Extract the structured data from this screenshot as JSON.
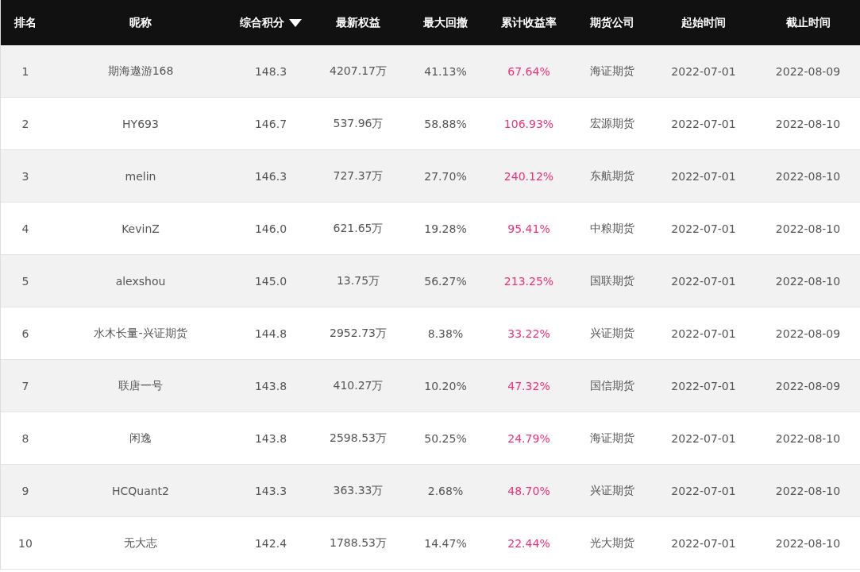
{
  "table": {
    "columns": [
      {
        "label": "排名",
        "sorted": false
      },
      {
        "label": "昵称",
        "sorted": false
      },
      {
        "label": "综合积分",
        "sorted": true
      },
      {
        "label": "最新权益",
        "sorted": false
      },
      {
        "label": "最大回撤",
        "sorted": false
      },
      {
        "label": "累计收益率",
        "sorted": false
      },
      {
        "label": "期货公司",
        "sorted": false
      },
      {
        "label": "起始时间",
        "sorted": false
      },
      {
        "label": "截止时间",
        "sorted": false
      }
    ],
    "rows": [
      [
        "1",
        "期海遨游168",
        "148.3",
        "4207.17万",
        "41.13%",
        "67.64%",
        "海证期货",
        "2022-07-01",
        "2022-08-09"
      ],
      [
        "2",
        "HY693",
        "146.7",
        "537.96万",
        "58.88%",
        "106.93%",
        "宏源期货",
        "2022-07-01",
        "2022-08-10"
      ],
      [
        "3",
        "melin",
        "146.3",
        "727.37万",
        "27.70%",
        "240.12%",
        "东航期货",
        "2022-07-01",
        "2022-08-10"
      ],
      [
        "4",
        "KevinZ",
        "146.0",
        "621.65万",
        "19.28%",
        "95.41%",
        "中粮期货",
        "2022-07-01",
        "2022-08-10"
      ],
      [
        "5",
        "alexshou",
        "145.0",
        "13.75万",
        "56.27%",
        "213.25%",
        "国联期货",
        "2022-07-01",
        "2022-08-10"
      ],
      [
        "6",
        "水木长量-兴证期货",
        "144.8",
        "2952.73万",
        "8.38%",
        "33.22%",
        "兴证期货",
        "2022-07-01",
        "2022-08-09"
      ],
      [
        "7",
        "联唐一号",
        "143.8",
        "410.27万",
        "10.20%",
        "47.32%",
        "国信期货",
        "2022-07-01",
        "2022-08-09"
      ],
      [
        "8",
        "闲逸",
        "143.8",
        "2598.53万",
        "50.25%",
        "24.79%",
        "海证期货",
        "2022-07-01",
        "2022-08-10"
      ],
      [
        "9",
        "HCQuant2",
        "143.3",
        "363.33万",
        "2.68%",
        "48.70%",
        "兴证期货",
        "2022-07-01",
        "2022-08-10"
      ],
      [
        "10",
        "无大志",
        "142.4",
        "1788.53万",
        "14.47%",
        "22.44%",
        "光大期货",
        "2022-07-01",
        "2022-08-10"
      ]
    ]
  }
}
